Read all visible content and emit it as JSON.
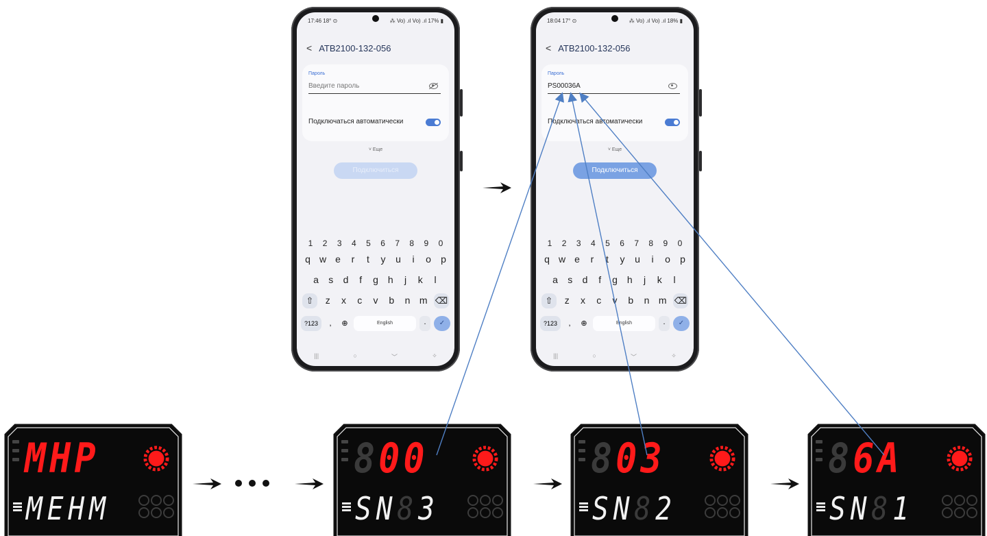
{
  "phones": [
    {
      "status_time": "17:46 18° ⊙",
      "status_sys": "⁂ Vo) .ıl Vo) .ıl 17% ▮",
      "title": "ATB2100-132-056",
      "password_label": "Пароль",
      "password_value": "",
      "password_placeholder": "Введите пароль",
      "auto_connect_label": "Подключаться автоматически",
      "more_label": "˅ Еще",
      "connect_label": "Подключиться",
      "connect_enabled": false,
      "keyboard": {
        "numbers": [
          "1",
          "2",
          "3",
          "4",
          "5",
          "6",
          "7",
          "8",
          "9",
          "0"
        ],
        "row1": [
          "q",
          "w",
          "e",
          "r",
          "t",
          "y",
          "u",
          "i",
          "o",
          "p"
        ],
        "row2": [
          "a",
          "s",
          "d",
          "f",
          "g",
          "h",
          "j",
          "k",
          "l"
        ],
        "row3": [
          "z",
          "x",
          "c",
          "v",
          "b",
          "n",
          "m"
        ],
        "mode_key": "?123",
        "comma": ",",
        "globe": "⊕",
        "space_label": "English",
        "period": ".",
        "ok": "✓"
      },
      "nav": [
        "|||",
        "○",
        "﹀",
        "✧"
      ]
    },
    {
      "status_time": "18:04 17° ⊙",
      "status_sys": "⁂ Vo) .ıl Vo) .ıl 18% ▮",
      "title": "ATB2100-132-056",
      "password_label": "Пароль",
      "password_value": "PS00036A",
      "password_placeholder": "",
      "auto_connect_label": "Подключаться автоматически",
      "more_label": "˅ Еще",
      "connect_label": "Подключиться",
      "connect_enabled": true,
      "keyboard": {
        "numbers": [
          "1",
          "2",
          "3",
          "4",
          "5",
          "6",
          "7",
          "8",
          "9",
          "0"
        ],
        "row1": [
          "q",
          "w",
          "e",
          "r",
          "t",
          "y",
          "u",
          "i",
          "o",
          "p"
        ],
        "row2": [
          "a",
          "s",
          "d",
          "f",
          "g",
          "h",
          "j",
          "k",
          "l"
        ],
        "row3": [
          "z",
          "x",
          "c",
          "v",
          "b",
          "n",
          "m"
        ],
        "mode_key": "?123",
        "comma": ",",
        "globe": "⊕",
        "space_label": "English",
        "period": ".",
        "ok": "✓"
      },
      "nav": [
        "|||",
        "○",
        "﹀",
        "✧"
      ]
    }
  ],
  "displays": [
    {
      "top_ghost": "",
      "top": "MHP",
      "bottom": "MEHM",
      "bottom_ghost": ""
    },
    {
      "top_ghost": "8",
      "top": "00",
      "bottom": "SN",
      "bottom_ghost": "8",
      "bottom_tail": "3"
    },
    {
      "top_ghost": "8",
      "top": "03",
      "bottom": "SN",
      "bottom_ghost": "8",
      "bottom_tail": "2"
    },
    {
      "top_ghost": "8",
      "top": "6A",
      "bottom": "SN",
      "bottom_ghost": "8",
      "bottom_tail": "1"
    }
  ],
  "colors": {
    "led_red": "#ff1a1a",
    "accent_blue": "#4a7bd3",
    "connector_line": "#4f7fc4"
  }
}
